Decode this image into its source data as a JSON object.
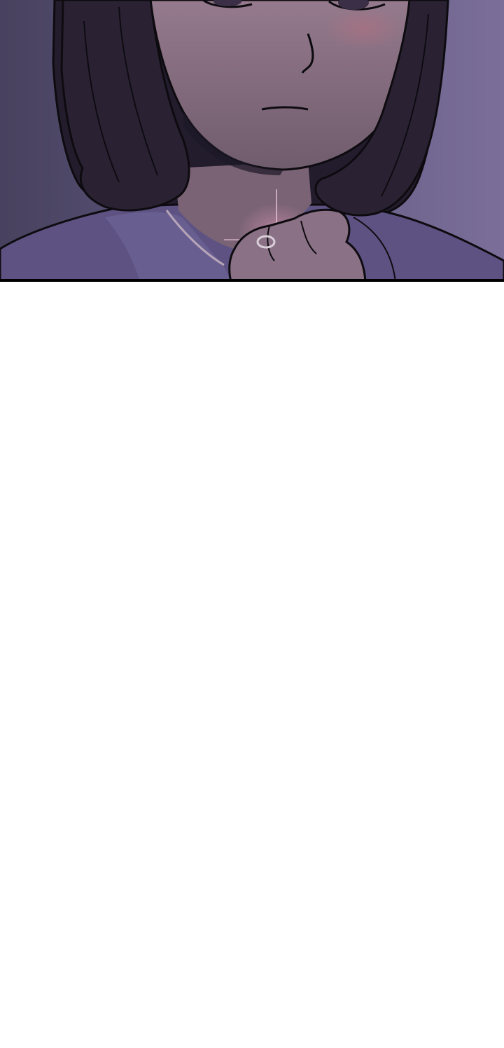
{
  "panel": {
    "subject": "illustration-panel",
    "colors": {
      "background_left": "#4a4566",
      "background_right": "#7a6e98",
      "hair": "#2a2233",
      "hair_shadow": "#1d1826",
      "skin": "#8f7488",
      "skin_shadow": "#73606f",
      "shirt": "#5d5282",
      "shirt_light": "#6c6194",
      "line": "#0e0b10",
      "glow": "#c58aa7",
      "border": "#000000"
    }
  },
  "gutter": {
    "color": "#ffffff"
  }
}
